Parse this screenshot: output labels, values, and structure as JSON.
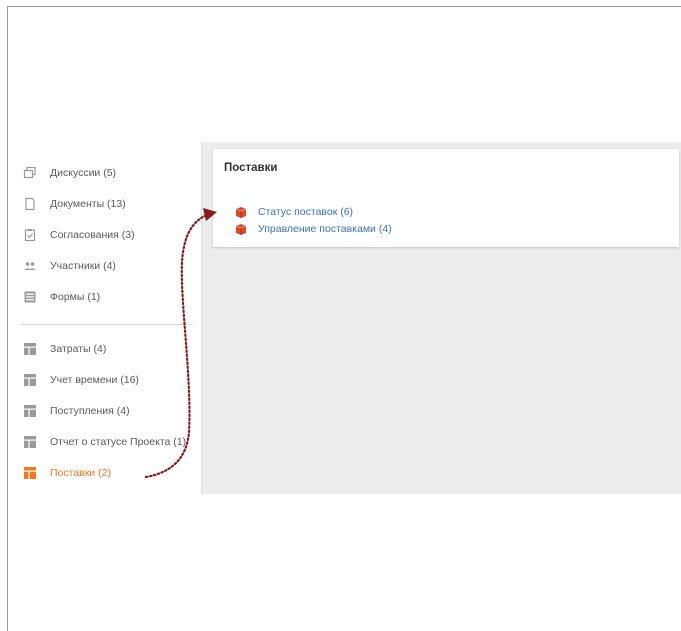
{
  "sidebar": {
    "group1": [
      {
        "label": "Дискуссии (5)",
        "icon": "discussions-icon"
      },
      {
        "label": "Документы (13)",
        "icon": "documents-icon"
      },
      {
        "label": "Согласования (3)",
        "icon": "approvals-icon"
      },
      {
        "label": "Участники (4)",
        "icon": "participants-icon"
      },
      {
        "label": "Формы (1)",
        "icon": "forms-icon"
      }
    ],
    "group2": [
      {
        "label": "Затраты (4)",
        "icon": "table-icon"
      },
      {
        "label": "Учет времени (16)",
        "icon": "table-icon"
      },
      {
        "label": "Поступления (4)",
        "icon": "table-icon"
      },
      {
        "label": "Отчет о статусе Проекта (1)",
        "icon": "table-icon"
      },
      {
        "label": "Поставки (2)",
        "icon": "table-icon",
        "active": true
      }
    ]
  },
  "panel": {
    "title": "Поставки",
    "links": [
      {
        "label": "Статус поставок (6)",
        "icon": "box-icon"
      },
      {
        "label": "Управление поставками (4)",
        "icon": "box-icon"
      }
    ]
  },
  "colors": {
    "accent": "#f07822",
    "link": "#3a73b8",
    "arrow": "#8b1a1a",
    "icon_gray": "#9a9a9a",
    "box_red": "#d64a2e"
  }
}
